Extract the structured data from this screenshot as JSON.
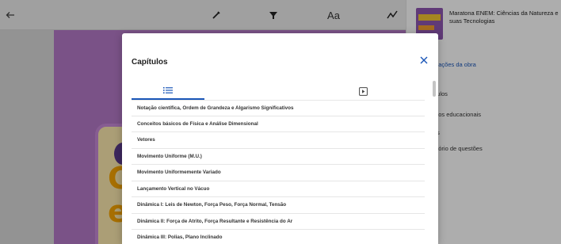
{
  "toolbar": {
    "back_icon": "arrow-left-icon",
    "pen_icon": "pen-icon",
    "highlighter_icon": "highlighter-icon",
    "font_label": "Aa",
    "draw_icon": "squiggle-icon"
  },
  "sidebar": {
    "book_title": "Maratona ENEM: Ciências da Natureza e suas Tecnologias",
    "items": [
      {
        "label": "mações da obra"
      },
      {
        "label": "ítulos"
      },
      {
        "label": "etos educacionais"
      },
      {
        "label": "as"
      },
      {
        "label": "atório de questões"
      }
    ]
  },
  "book": {
    "letters": [
      "C",
      "e"
    ]
  },
  "modal": {
    "title": "Capítulos",
    "close_icon": "close-icon",
    "tabs": [
      {
        "icon": "list-icon",
        "active": true
      },
      {
        "icon": "video-icon",
        "active": false
      }
    ],
    "chapters": [
      "Notação científica, Ordem de Grandeza e Algarismo Significativos",
      "Conceitos básicos de Física e Análise Dimensional",
      "Vetores",
      "Movimento Uniforme (M.U.)",
      "Movimento Uniformemente Variado",
      "Lançamento Vertical no Vácuo",
      "Dinâmica I: Leis de Newton, Força Peso, Força Normal, Tensão",
      "Dinâmica II: Força de Atrito, Força Resultante e Resistência do Ar",
      "Dinâmica III: Polias, Plano Inclinado"
    ]
  },
  "colors": {
    "accent": "#1a56b8",
    "book_purple": "#b47ac8",
    "book_yellow": "#f6a400"
  }
}
